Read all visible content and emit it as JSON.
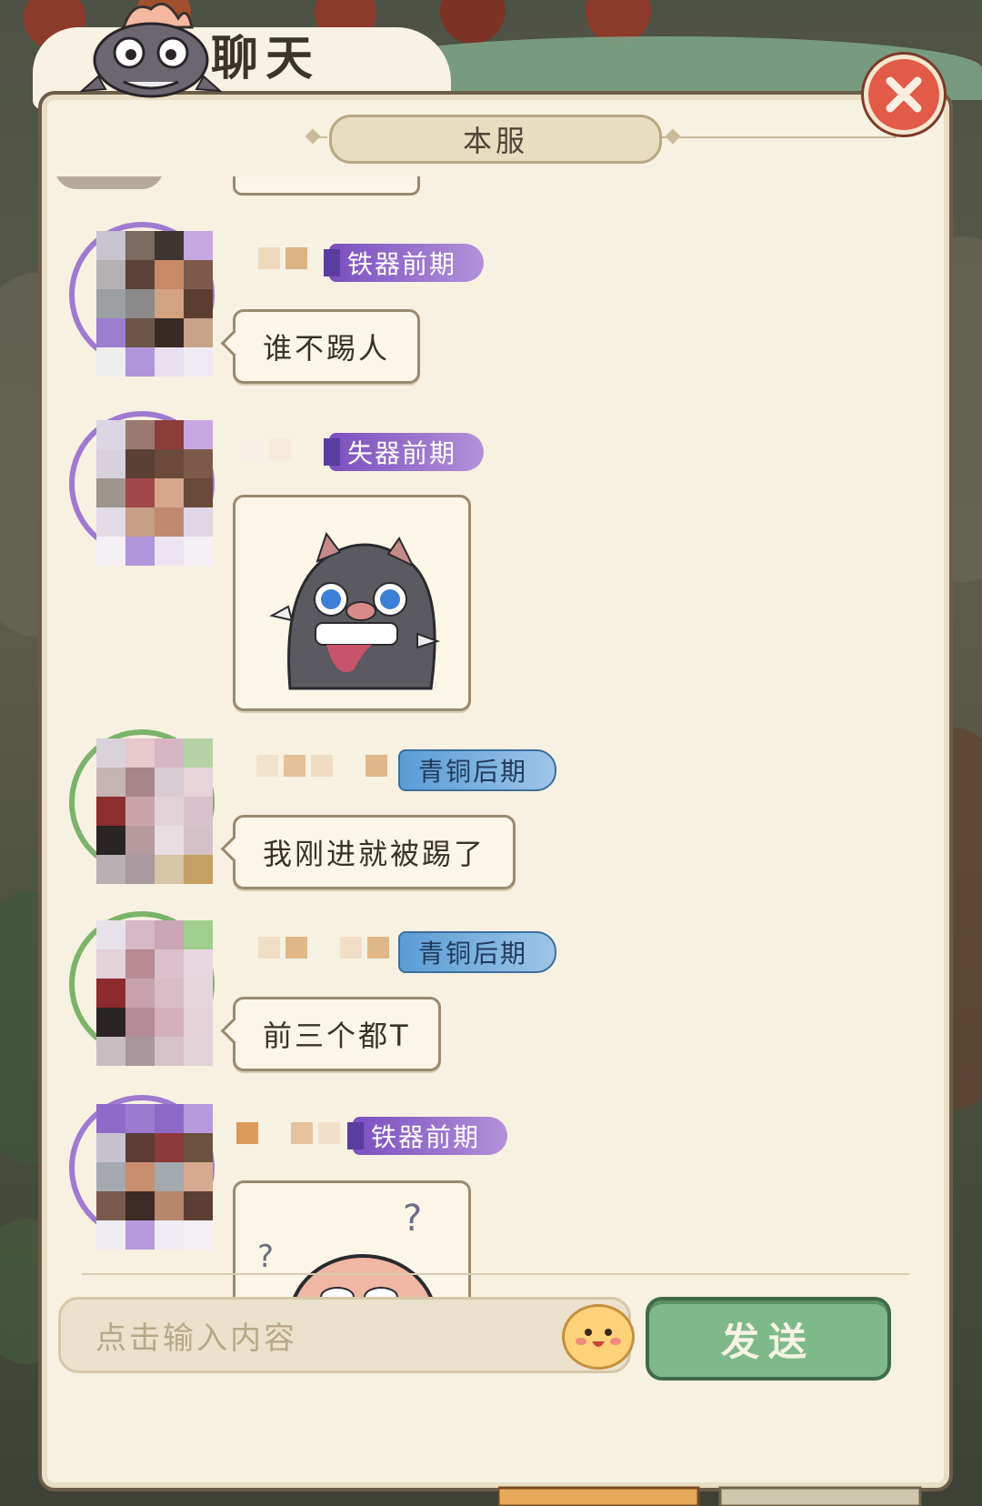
{
  "window": {
    "title": "聊天"
  },
  "channel_tab": {
    "label": "本服"
  },
  "messages": [
    {
      "rank": "铁器前期",
      "text": "谁不踢人"
    },
    {
      "rank": "失器前期",
      "sticker": "boar-sticker"
    },
    {
      "rank": "青铜后期",
      "text": "我刚进就被踢了"
    },
    {
      "rank": "青铜后期",
      "text": "前三个都T"
    },
    {
      "rank": "铁器前期",
      "sticker": "confused-face-sticker"
    }
  ],
  "input": {
    "placeholder": "点击输入内容"
  },
  "send_button": {
    "label": "发送"
  },
  "colors": {
    "panel": "#f7f1e2",
    "send": "#7fb98a",
    "iron_badge": "#8f66c8",
    "bronze_badge": "#6aa6dc",
    "close": "#e25b48"
  }
}
